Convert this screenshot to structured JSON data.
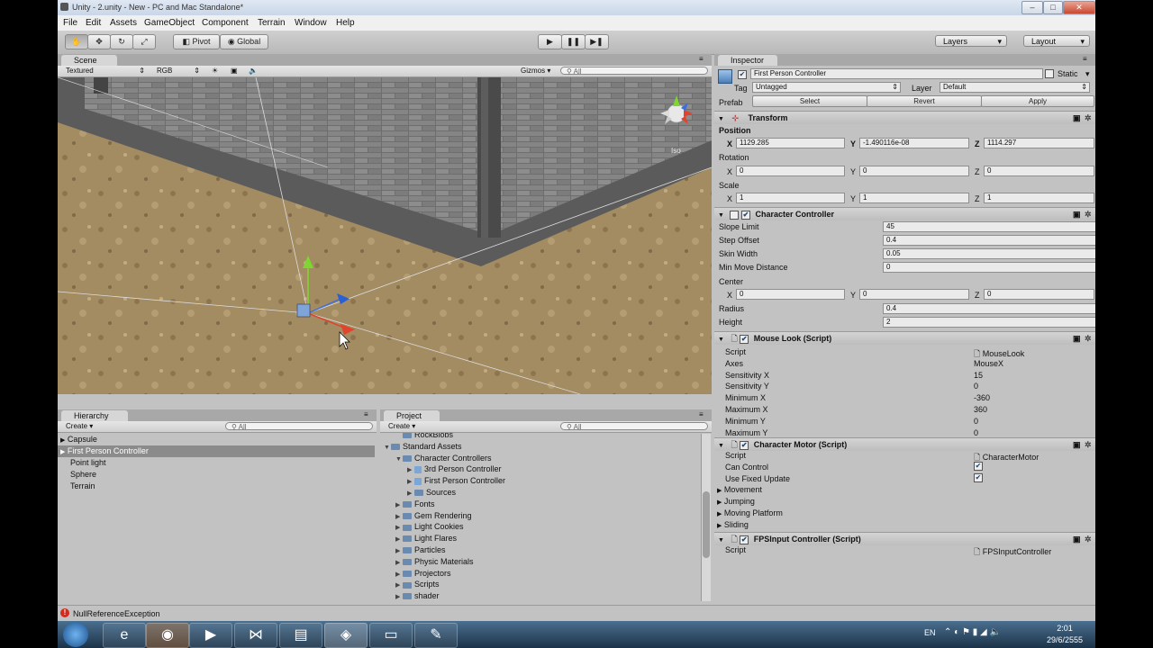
{
  "window": {
    "title": "Unity - 2.unity - New - PC and Mac Standalone*",
    "controls": [
      "–",
      "□",
      "✕"
    ]
  },
  "menu": [
    "File",
    "Edit",
    "Assets",
    "GameObject",
    "Component",
    "Terrain",
    "Window",
    "Help"
  ],
  "toolbar": {
    "pivot_label": "Pivot",
    "global_label": "Global",
    "layers_label": "Layers",
    "layout_label": "Layout"
  },
  "scene": {
    "tab": "Scene",
    "render_mode": "Textured",
    "color_mode": "RGB",
    "gizmos_label": "Gizmos",
    "search_placeholder": "All",
    "gizmo_label": "Iso"
  },
  "hierarchy": {
    "tab": "Hierarchy",
    "create_label": "Create",
    "search_placeholder": "All",
    "items": [
      "Capsule",
      "First Person Controller",
      "Point light",
      "Sphere",
      "Terrain"
    ],
    "selected": "First Person Controller"
  },
  "project": {
    "tab": "Project",
    "create_label": "Create",
    "search_placeholder": "All",
    "items": [
      {
        "label": "RockBlobs",
        "depth": 1,
        "arrow": false
      },
      {
        "label": "Standard Assets",
        "depth": 0,
        "arrow": "open"
      },
      {
        "label": "Character Controllers",
        "depth": 1,
        "arrow": "open"
      },
      {
        "label": "3rd Person Controller",
        "depth": 2,
        "arrow": "closed",
        "prefab": true
      },
      {
        "label": "First Person Controller",
        "depth": 2,
        "arrow": "closed",
        "prefab": true
      },
      {
        "label": "Sources",
        "depth": 2,
        "arrow": "closed"
      },
      {
        "label": "Fonts",
        "depth": 1,
        "arrow": "closed"
      },
      {
        "label": "Gem Rendering",
        "depth": 1,
        "arrow": "closed"
      },
      {
        "label": "Light Cookies",
        "depth": 1,
        "arrow": "closed"
      },
      {
        "label": "Light Flares",
        "depth": 1,
        "arrow": "closed"
      },
      {
        "label": "Particles",
        "depth": 1,
        "arrow": "closed"
      },
      {
        "label": "Physic Materials",
        "depth": 1,
        "arrow": "closed"
      },
      {
        "label": "Projectors",
        "depth": 1,
        "arrow": "closed"
      },
      {
        "label": "Scripts",
        "depth": 1,
        "arrow": "closed"
      },
      {
        "label": "shader",
        "depth": 1,
        "arrow": "closed"
      }
    ]
  },
  "inspector": {
    "tab": "Inspector",
    "object_name": "First Person Controller",
    "static_label": "Static",
    "tag_label": "Tag",
    "tag_value": "Untagged",
    "layer_label": "Layer",
    "layer_value": "Default",
    "prefab_label": "Prefab",
    "select_label": "Select",
    "revert_label": "Revert",
    "apply_label": "Apply",
    "transform": {
      "title": "Transform",
      "position_label": "Position",
      "rotation_label": "Rotation",
      "scale_label": "Scale",
      "x": "X",
      "y": "Y",
      "z": "Z",
      "position": [
        "1129.285",
        "-1.490116e-08",
        "1114.297"
      ],
      "rotation": [
        "0",
        "0",
        "0"
      ],
      "scale": [
        "1",
        "1",
        "1"
      ]
    },
    "character_controller": {
      "title": "Character Controller",
      "slope_limit_label": "Slope Limit",
      "slope_limit": "45",
      "step_offset_label": "Step Offset",
      "step_offset": "0.4",
      "skin_width_label": "Skin Width",
      "skin_width": "0.05",
      "min_move_label": "Min Move Distance",
      "min_move": "0",
      "center_label": "Center",
      "center": [
        "0",
        "0",
        "0"
      ],
      "radius_label": "Radius",
      "radius": "0.4",
      "height_label": "Height",
      "height": "2"
    },
    "mouse_look": {
      "title": "Mouse Look (Script)",
      "rows": [
        {
          "label": "Script",
          "value": "MouseLook",
          "asset": true
        },
        {
          "label": "Axes",
          "value": "MouseX"
        },
        {
          "label": "Sensitivity X",
          "value": "15"
        },
        {
          "label": "Sensitivity Y",
          "value": "0"
        },
        {
          "label": "Minimum X",
          "value": "-360"
        },
        {
          "label": "Maximum X",
          "value": "360"
        },
        {
          "label": "Minimum Y",
          "value": "0"
        },
        {
          "label": "Maximum Y",
          "value": "0"
        }
      ]
    },
    "character_motor": {
      "title": "Character Motor (Script)",
      "script_label": "Script",
      "script_value": "CharacterMotor",
      "can_control_label": "Can Control",
      "fixed_update_label": "Use Fixed Update",
      "foldouts": [
        "Movement",
        "Jumping",
        "Moving Platform",
        "Sliding"
      ]
    },
    "fps_input": {
      "title": "FPSInput Controller (Script)",
      "script_label": "Script",
      "script_value": "FPSInputController"
    }
  },
  "status": {
    "message": "NullReferenceException"
  },
  "taskbar": {
    "language": "EN",
    "time": "2:01",
    "date": "29/6/2555"
  }
}
